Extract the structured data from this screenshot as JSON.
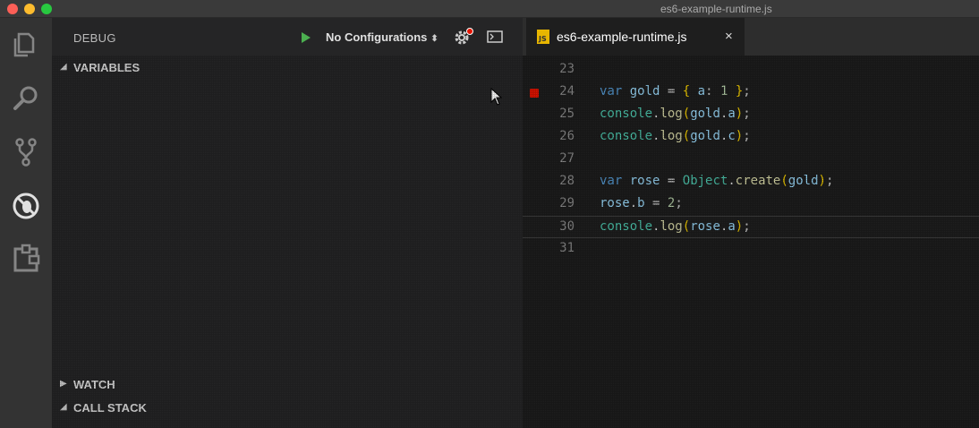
{
  "window": {
    "title": "es6-example-runtime.js"
  },
  "activity_bar": {
    "items": [
      {
        "icon": "files-icon"
      },
      {
        "icon": "search-icon"
      },
      {
        "icon": "source-control-icon"
      },
      {
        "icon": "debug-icon"
      },
      {
        "icon": "extensions-icon"
      }
    ]
  },
  "debug": {
    "title": "DEBUG",
    "configuration": "No Configurations",
    "start_icon": "play-icon",
    "settings_icon": "gear-icon",
    "console_icon": "console-icon"
  },
  "sections": {
    "variables": "VARIABLES",
    "watch": "WATCH",
    "call_stack": "CALL STACK"
  },
  "editor": {
    "tab_label": "es6-example-runtime.js",
    "tab_close": "×",
    "lines": [
      {
        "number": "23",
        "code": ""
      },
      {
        "number": "24",
        "code": "var gold = { a: 1 };",
        "breakpoint": true
      },
      {
        "number": "25",
        "code": "console.log(gold.a);"
      },
      {
        "number": "26",
        "code": "console.log(gold.c);"
      },
      {
        "number": "27",
        "code": ""
      },
      {
        "number": "28",
        "code": "var rose = Object.create(gold);"
      },
      {
        "number": "29",
        "code": "rose.b = 2;"
      },
      {
        "number": "30",
        "code": "console.log(rose.a);",
        "current": true
      },
      {
        "number": "31",
        "code": ""
      }
    ]
  },
  "colors": {
    "accent_run": "#4caf50",
    "breakpoint": "#e51400",
    "keyword": "#569cd6",
    "identifier": "#9cdcfe",
    "function": "#dcdcaa"
  }
}
